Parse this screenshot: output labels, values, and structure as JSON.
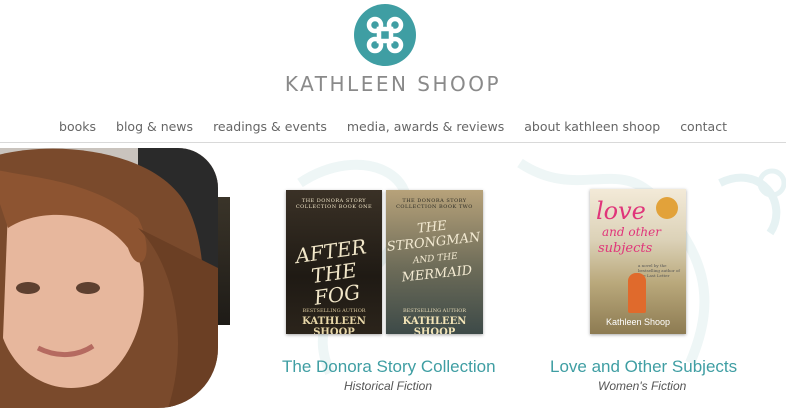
{
  "site": {
    "brand": "KATHLEEN SHOOP"
  },
  "nav": {
    "items": [
      {
        "label": "books"
      },
      {
        "label": "blog & news"
      },
      {
        "label": "readings & events"
      },
      {
        "label": "media, awards & reviews"
      },
      {
        "label": "about kathleen shoop"
      },
      {
        "label": "contact"
      }
    ]
  },
  "books": [
    {
      "collection_title": "The Donora Story Collection",
      "genre": "Historical Fiction",
      "covers": [
        {
          "series": "THE DONORA STORY COLLECTION BOOK ONE",
          "title_line1": "AFTER THE",
          "title_line2": "FOG",
          "tag": "BESTSELLING AUTHOR",
          "author": "KATHLEEN SHOOP"
        },
        {
          "series": "THE DONORA STORY COLLECTION BOOK TWO",
          "title_line1": "THE",
          "title_line2": "STRONGMAN",
          "title_line3": "AND THE",
          "title_line4": "MERMAID",
          "tag": "BESTSELLING AUTHOR",
          "author": "KATHLEEN SHOOP"
        }
      ]
    },
    {
      "collection_title": "Love and Other Subjects",
      "genre": "Women's Fiction",
      "covers": [
        {
          "title_line1": "love",
          "title_line2": "and other",
          "title_line3": "subjects",
          "blurb": "a novel by the bestselling author of The Last Letter",
          "author": "Kathleen Shoop"
        }
      ]
    }
  ],
  "colors": {
    "accent": "#3f9ea3",
    "nav_text": "#666666",
    "brand_text": "#8a8a8a"
  },
  "icons": {
    "logo": "command-key-icon"
  }
}
